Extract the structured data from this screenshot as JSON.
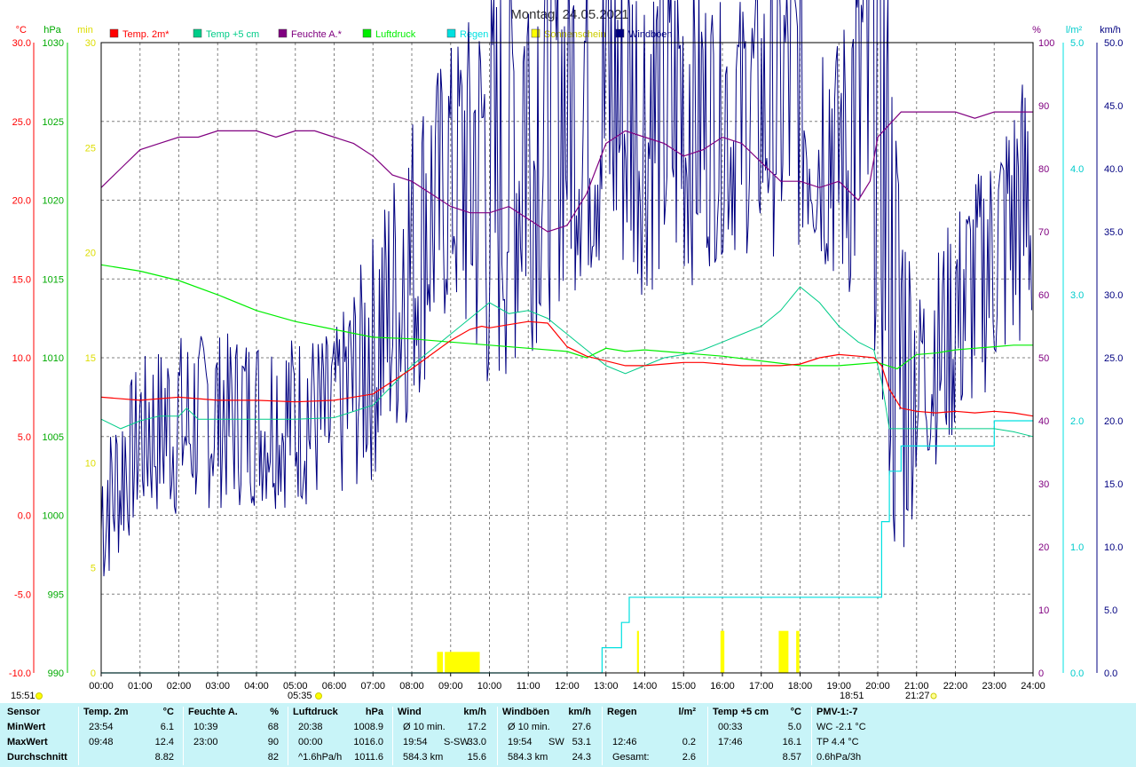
{
  "title": "Montag, 24.05.2021",
  "colors": {
    "temp2m": "#ff0000",
    "temp5cm": "#00cc88",
    "humidity": "#800080",
    "pressure": "#00ee00",
    "rain": "#00e0e0",
    "sun": "#ffff00",
    "gust": "#000080",
    "grid": "#808080",
    "stats_bg": "#c8f4f8"
  },
  "axes": {
    "temp_unit": "°C",
    "pressure_unit": "hPa",
    "sun_unit": "min",
    "humidity_unit": "%",
    "rain_unit": "l/m²",
    "wind_unit": "km/h"
  },
  "markers": {
    "left_time": "15:51",
    "sunrise": "05:35",
    "sunset": "18:51",
    "moon": "21:27"
  },
  "chart_data": {
    "type": "line",
    "title": "Montag, 24.05.2021",
    "x_range_hours": [
      0,
      24
    ],
    "x_ticks": [
      "00:00",
      "01:00",
      "02:00",
      "03:00",
      "04:00",
      "05:00",
      "06:00",
      "07:00",
      "08:00",
      "09:00",
      "10:00",
      "11:00",
      "12:00",
      "13:00",
      "14:00",
      "15:00",
      "16:00",
      "17:00",
      "18:00",
      "19:00",
      "20:00",
      "21:00",
      "22:00",
      "23:00",
      "24:00"
    ],
    "axes": {
      "temperature": {
        "unit": "°C",
        "range": [
          -10,
          30
        ],
        "ticks": [
          "30.0",
          "25.0",
          "20.0",
          "15.0",
          "10.0",
          "5.0",
          "0.0",
          "-5.0",
          "-10.0"
        ]
      },
      "pressure": {
        "unit": "hPa",
        "range": [
          990,
          1030
        ],
        "ticks": [
          "1030",
          "1025",
          "1020",
          "1015",
          "1010",
          "1005",
          "1000",
          "995",
          "990"
        ]
      },
      "sunshine": {
        "unit": "min",
        "range": [
          0,
          30
        ],
        "ticks": [
          "30",
          "25",
          "20",
          "15",
          "10",
          "5",
          "0"
        ]
      },
      "humidity": {
        "unit": "%",
        "range": [
          0,
          100
        ],
        "ticks": [
          "100",
          "90",
          "80",
          "70",
          "60",
          "50",
          "40",
          "30",
          "20",
          "10",
          "0"
        ]
      },
      "rain": {
        "unit": "l/m²",
        "range": [
          0,
          5
        ],
        "ticks": [
          "5.0",
          "4.0",
          "3.0",
          "2.0",
          "1.0",
          "0.0"
        ]
      },
      "wind": {
        "unit": "km/h",
        "range": [
          0,
          50
        ],
        "ticks": [
          "50.0",
          "45.0",
          "40.0",
          "35.0",
          "30.0",
          "25.0",
          "20.0",
          "15.0",
          "10.0",
          "5.0",
          "0.0"
        ]
      }
    },
    "legend_position": "top",
    "series": [
      {
        "name": "Temp. 2m*",
        "axis": "temperature",
        "color": "#ff0000",
        "x": [
          0,
          1,
          2,
          3,
          4,
          5,
          6,
          7,
          7.5,
          8,
          8.5,
          9,
          9.5,
          9.8,
          10,
          10.5,
          11,
          11.5,
          12,
          12.5,
          13,
          13.5,
          14,
          14.5,
          15,
          15.5,
          16,
          16.5,
          17,
          17.5,
          18,
          18.5,
          19,
          19.5,
          19.9,
          20.1,
          20.3,
          20.6,
          21,
          21.5,
          22,
          22.5,
          23,
          23.5,
          24
        ],
        "y": [
          7.5,
          7.3,
          7.5,
          7.3,
          7.3,
          7.2,
          7.3,
          7.7,
          8.5,
          9.3,
          10.2,
          11.1,
          11.8,
          12.0,
          11.9,
          12.1,
          12.3,
          12.2,
          10.7,
          10.1,
          9.8,
          9.5,
          9.5,
          9.6,
          9.7,
          9.7,
          9.6,
          9.5,
          9.5,
          9.5,
          9.6,
          10.0,
          10.2,
          10.1,
          10.0,
          9.5,
          8.0,
          6.8,
          6.6,
          6.5,
          6.6,
          6.5,
          6.6,
          6.5,
          6.3
        ]
      },
      {
        "name": "Temp +5 cm",
        "axis": "temperature",
        "color": "#00cc88",
        "x": [
          0,
          0.5,
          1,
          1.5,
          2,
          2.2,
          2.5,
          3,
          4,
          5,
          6,
          7,
          8,
          8.5,
          9,
          9.5,
          10,
          10.5,
          11,
          11.5,
          12,
          12.5,
          13,
          13.5,
          14,
          14.5,
          15,
          15.5,
          16,
          16.5,
          17,
          17.5,
          18,
          18.5,
          19,
          19.5,
          19.9,
          20.1,
          20.3,
          21,
          22,
          23,
          23.5,
          24
        ],
        "y": [
          6.1,
          5.5,
          6.0,
          6.3,
          6.3,
          6.8,
          6.1,
          6.1,
          6.1,
          6.1,
          6.2,
          7.0,
          9.5,
          10.5,
          11.5,
          12.5,
          13.5,
          12.8,
          13.0,
          12.5,
          11.5,
          10.5,
          9.5,
          9.0,
          9.5,
          10.0,
          10.2,
          10.5,
          11.0,
          11.5,
          12.0,
          13.0,
          14.5,
          13.5,
          12.0,
          11.0,
          10.5,
          8.5,
          5.5,
          5.5,
          5.5,
          5.5,
          5.3,
          5.0
        ]
      },
      {
        "name": "Feuchte A.*",
        "axis": "humidity",
        "color": "#800080",
        "x": [
          0,
          0.5,
          1,
          1.5,
          2,
          2.5,
          3,
          3.5,
          4,
          4.5,
          5,
          5.5,
          6,
          6.5,
          7,
          7.5,
          8,
          8.5,
          9,
          9.5,
          10,
          10.5,
          11,
          11.5,
          12,
          12.5,
          13,
          13.5,
          14,
          14.5,
          15,
          15.5,
          16,
          16.5,
          17,
          17.5,
          18,
          18.5,
          19,
          19.5,
          19.8,
          20,
          20.3,
          20.6,
          21,
          21.5,
          22,
          22.5,
          23,
          23.5,
          24
        ],
        "y": [
          77,
          80,
          83,
          84,
          85,
          85,
          86,
          86,
          86,
          85,
          86,
          86,
          85,
          84,
          82,
          79,
          78,
          76,
          74,
          73,
          73,
          74,
          72,
          70,
          71,
          76,
          84,
          86,
          85,
          84,
          82,
          83,
          85,
          84,
          81,
          78,
          78,
          77,
          78,
          75,
          78,
          85,
          87,
          89,
          89,
          89,
          89,
          88,
          89,
          89,
          89
        ]
      },
      {
        "name": "Luftdruck",
        "axis": "pressure",
        "color": "#00ee00",
        "x": [
          0,
          1,
          2,
          3,
          4,
          5,
          6,
          7,
          8,
          9,
          10,
          11,
          12,
          12.5,
          13,
          13.5,
          14,
          15,
          16,
          17,
          18,
          19,
          19.5,
          20,
          20.5,
          21,
          21.5,
          22,
          22.5,
          23,
          23.5,
          24
        ],
        "y": [
          1015.9,
          1015.5,
          1014.9,
          1014.0,
          1013.0,
          1012.3,
          1011.8,
          1011.3,
          1011.2,
          1011.0,
          1010.8,
          1010.6,
          1010.4,
          1010.0,
          1010.6,
          1010.4,
          1010.5,
          1010.3,
          1010.1,
          1009.8,
          1009.5,
          1009.5,
          1009.6,
          1009.7,
          1009.3,
          1010.2,
          1010.3,
          1010.5,
          1010.6,
          1010.7,
          1010.8,
          1010.8
        ]
      },
      {
        "name": "Regen",
        "axis": "rain",
        "color": "#00e0e0",
        "x": [
          0,
          12.85,
          12.9,
          13.3,
          13.4,
          13.55,
          13.6,
          19.9,
          20.0,
          20.1,
          20.3,
          20.5,
          20.6,
          21,
          21.5,
          22,
          22.5,
          22.8,
          23,
          24
        ],
        "y": [
          0,
          0,
          0.2,
          0.2,
          0.4,
          0.4,
          0.6,
          0.6,
          0.6,
          1.2,
          1.6,
          1.6,
          1.8,
          1.8,
          1.8,
          1.8,
          1.8,
          1.8,
          2.0,
          2.0
        ]
      },
      {
        "name": "Sonnenschein",
        "axis": "sunshine",
        "color": "#ffff00",
        "bars": [
          [
            8.65,
            8.8,
            1.0
          ],
          [
            8.85,
            9.75,
            1.0
          ],
          [
            13.8,
            13.85,
            2.0
          ],
          [
            15.95,
            16.05,
            2.0
          ],
          [
            17.45,
            17.7,
            2.0
          ],
          [
            17.9,
            17.98,
            2.0
          ]
        ]
      },
      {
        "name": "Windböen",
        "axis": "wind",
        "color": "#000080",
        "envelope": {
          "x": [
            0,
            1,
            2,
            3,
            4,
            5,
            6,
            7,
            8,
            9,
            10,
            11,
            12,
            13,
            14,
            15,
            16,
            17,
            18,
            19,
            20,
            20.5,
            21,
            22,
            23,
            24
          ],
          "low": [
            6,
            12,
            12,
            13,
            13,
            13,
            13,
            15,
            20,
            28,
            20,
            25,
            30,
            30,
            30,
            30,
            33,
            33,
            33,
            30,
            25,
            3,
            15,
            18,
            23,
            25
          ],
          "high": [
            18,
            25,
            27,
            27,
            27,
            27,
            27,
            35,
            45,
            50,
            55,
            60,
            58,
            60,
            57,
            57,
            53,
            55,
            58,
            50,
            68,
            45,
            30,
            37,
            42,
            50
          ]
        }
      }
    ]
  },
  "stats": {
    "headers": [
      {
        "label": "Sensor",
        "unit": ""
      },
      {
        "label": "Temp. 2m",
        "unit": "°C"
      },
      {
        "label": "Feuchte A.",
        "unit": "%"
      },
      {
        "label": "Luftdruck",
        "unit": "hPa"
      },
      {
        "label": "Wind",
        "unit": "km/h"
      },
      {
        "label": "Windböen",
        "unit": "km/h"
      },
      {
        "label": "Regen",
        "unit": "l/m²"
      },
      {
        "label": "Temp +5 cm",
        "unit": "°C"
      },
      {
        "label": "PMV-1:-7",
        "unit": ""
      }
    ],
    "rows": [
      {
        "label": "MinWert",
        "temp": [
          "23:54",
          "6.1"
        ],
        "hum": [
          "10:39",
          "68"
        ],
        "press": [
          "20:38",
          "1008.9"
        ],
        "wind": [
          "Ø 10 min.",
          "",
          "17.2"
        ],
        "gust": [
          "Ø 10 min.",
          "",
          "27.6"
        ],
        "rain": [
          "",
          ""
        ],
        "t5": [
          "00:33",
          "5.0"
        ],
        "pmv": "WC -2.1 °C"
      },
      {
        "label": "MaxWert",
        "temp": [
          "09:48",
          "12.4"
        ],
        "hum": [
          "23:00",
          "90"
        ],
        "press": [
          "00:00",
          "1016.0"
        ],
        "wind": [
          "19:54",
          "S-SW",
          "33.0"
        ],
        "gust": [
          "19:54",
          "SW",
          "53.1"
        ],
        "rain": [
          "12:46",
          "0.2"
        ],
        "t5": [
          "17:46",
          "16.1"
        ],
        "pmv": "TP 4.4 °C"
      },
      {
        "label": "Durchschnitt",
        "temp": [
          "",
          "8.82"
        ],
        "hum": [
          "",
          "82"
        ],
        "press": [
          "^1.6hPa/h",
          "1011.6"
        ],
        "wind": [
          "584.3 km",
          "",
          "15.6"
        ],
        "gust": [
          "584.3 km",
          "",
          "24.3"
        ],
        "rain": [
          "Gesamt:",
          "2.6"
        ],
        "t5": [
          "",
          "8.57"
        ],
        "pmv": "0.6hPa/3h"
      }
    ]
  }
}
